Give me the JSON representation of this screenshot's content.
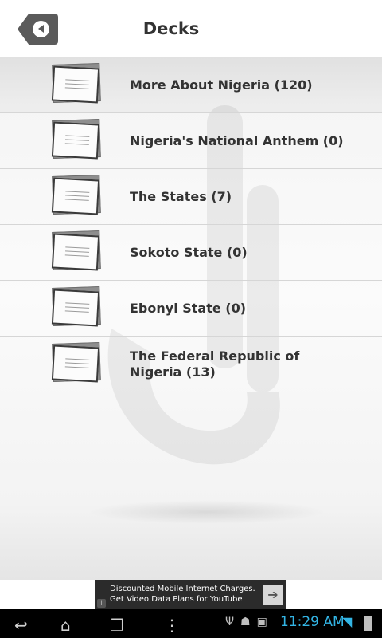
{
  "header": {
    "title": "Decks"
  },
  "decks": [
    {
      "label": "More About Nigeria (120)"
    },
    {
      "label": "Nigeria's National Anthem (0)"
    },
    {
      "label": "The States (7)"
    },
    {
      "label": "Sokoto State (0)"
    },
    {
      "label": "Ebonyi State (0)"
    },
    {
      "label": "The Federal Republic of Nigeria (13)"
    }
  ],
  "ad": {
    "line1": "Discounted Mobile Internet Charges.",
    "line2": "Get Video Data Plans for YouTube!"
  },
  "status": {
    "time": "11:29 AM"
  },
  "colors": {
    "accent": "#33b5e5",
    "header_text": "#333333",
    "back_button": "#5b5b5b"
  }
}
